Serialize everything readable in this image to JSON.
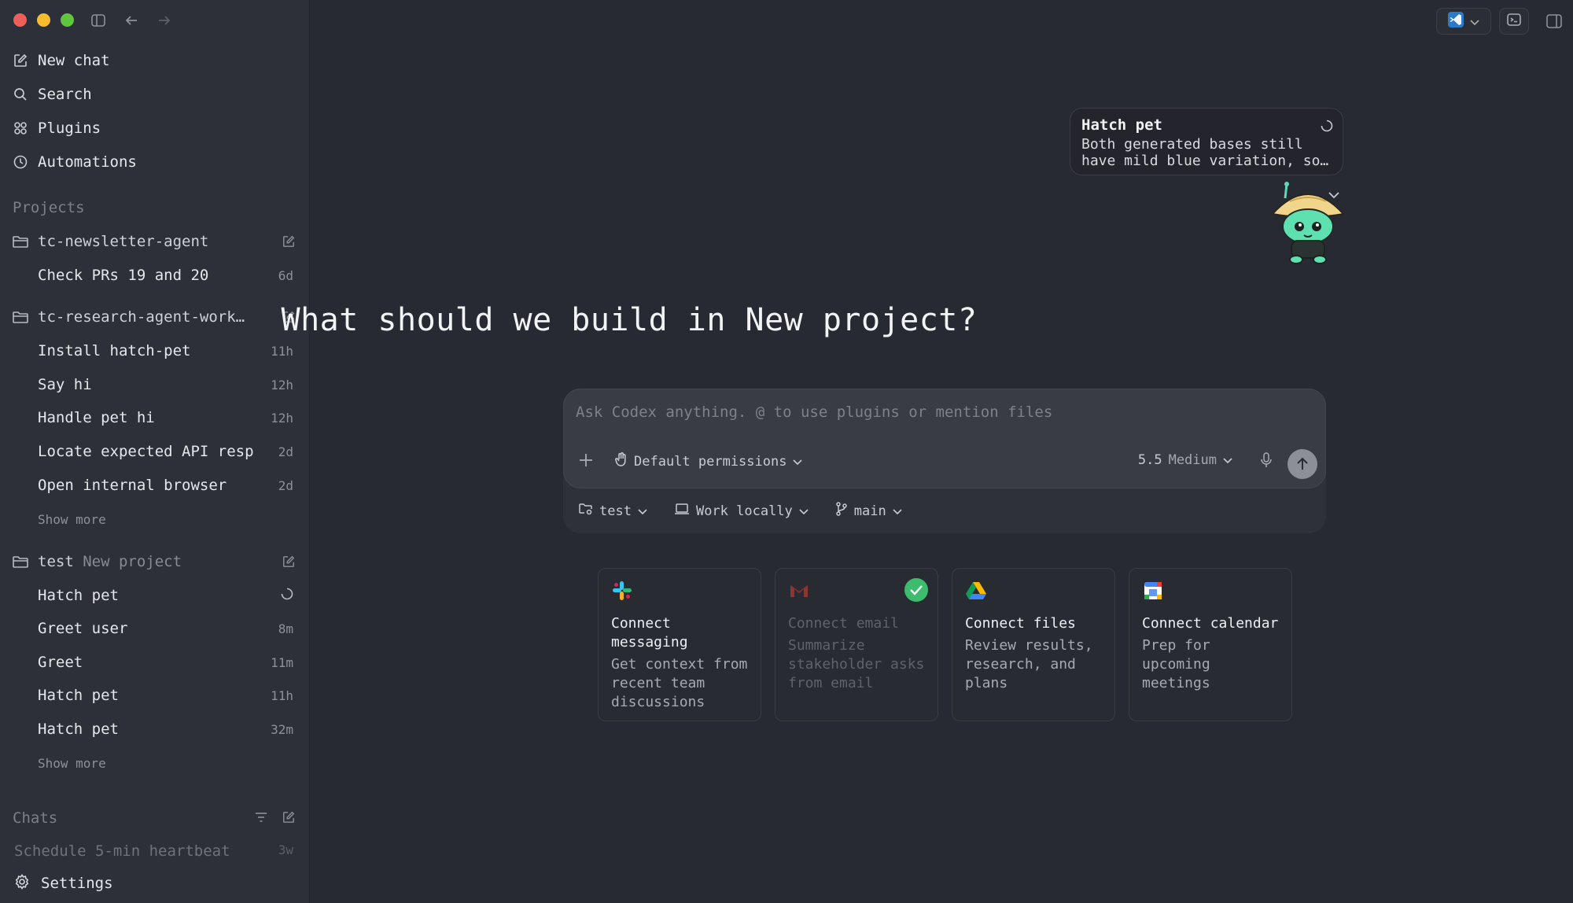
{
  "sidebar": {
    "nav": [
      {
        "label": "New chat",
        "icon": "edit-icon"
      },
      {
        "label": "Search",
        "icon": "search-icon"
      },
      {
        "label": "Plugins",
        "icon": "grid-icon"
      },
      {
        "label": "Automations",
        "icon": "clock-icon"
      }
    ],
    "projects_label": "Projects",
    "projects": [
      {
        "name": "tc-newsletter-agent",
        "threads": [
          {
            "title": "Check PRs 19 and 20",
            "age": "6d"
          }
        ]
      },
      {
        "name": "tc-research-agent-work…",
        "threads": [
          {
            "title": "Install hatch-pet",
            "age": "11h"
          },
          {
            "title": "Say hi",
            "age": "12h"
          },
          {
            "title": "Handle pet hi",
            "age": "12h"
          },
          {
            "title": "Locate expected API resp…",
            "age": "2d"
          },
          {
            "title": "Open internal browser",
            "age": "2d"
          }
        ],
        "show_more": "Show more"
      },
      {
        "name": "test",
        "subname": "New project",
        "threads": [
          {
            "title": "Hatch pet",
            "age": ""
          },
          {
            "title": "Greet user",
            "age": "8m"
          },
          {
            "title": "Greet",
            "age": "11m"
          },
          {
            "title": "Hatch pet",
            "age": "11h"
          },
          {
            "title": "Hatch pet",
            "age": "32m"
          }
        ],
        "show_more": "Show more"
      }
    ],
    "chats_label": "Chats",
    "chats": [
      {
        "title": "Schedule 5-min heartbeat",
        "age": "3w"
      }
    ],
    "settings_label": "Settings"
  },
  "pet": {
    "title": "Hatch pet",
    "text_line1": "Both generated bases still",
    "text_line2": "have mild blue variation, so…"
  },
  "main": {
    "headline": "What should we build in New project?",
    "composer": {
      "placeholder": "Ask Codex anything. @ to use plugins or mention files",
      "permissions": "Default permissions",
      "model_version": "5.5",
      "model_effort": "Medium"
    },
    "context": {
      "project": "test",
      "location": "Work locally",
      "branch": "main"
    },
    "cards": [
      {
        "title": "Connect messaging",
        "desc": "Get context from recent team discussions",
        "logo": "slack-icon",
        "connected": false
      },
      {
        "title": "Connect email",
        "desc": "Summarize stakeholder asks from email",
        "logo": "gmail-icon",
        "connected": true
      },
      {
        "title": "Connect files",
        "desc": "Review results, research, and plans",
        "logo": "drive-icon",
        "connected": false
      },
      {
        "title": "Connect calendar",
        "desc": "Prep for upcoming meetings",
        "logo": "calendar-icon",
        "connected": false
      }
    ]
  },
  "colors": {
    "background": "#282a33",
    "sidebar": "#2e3039",
    "accent_green": "#3fbb6d"
  }
}
